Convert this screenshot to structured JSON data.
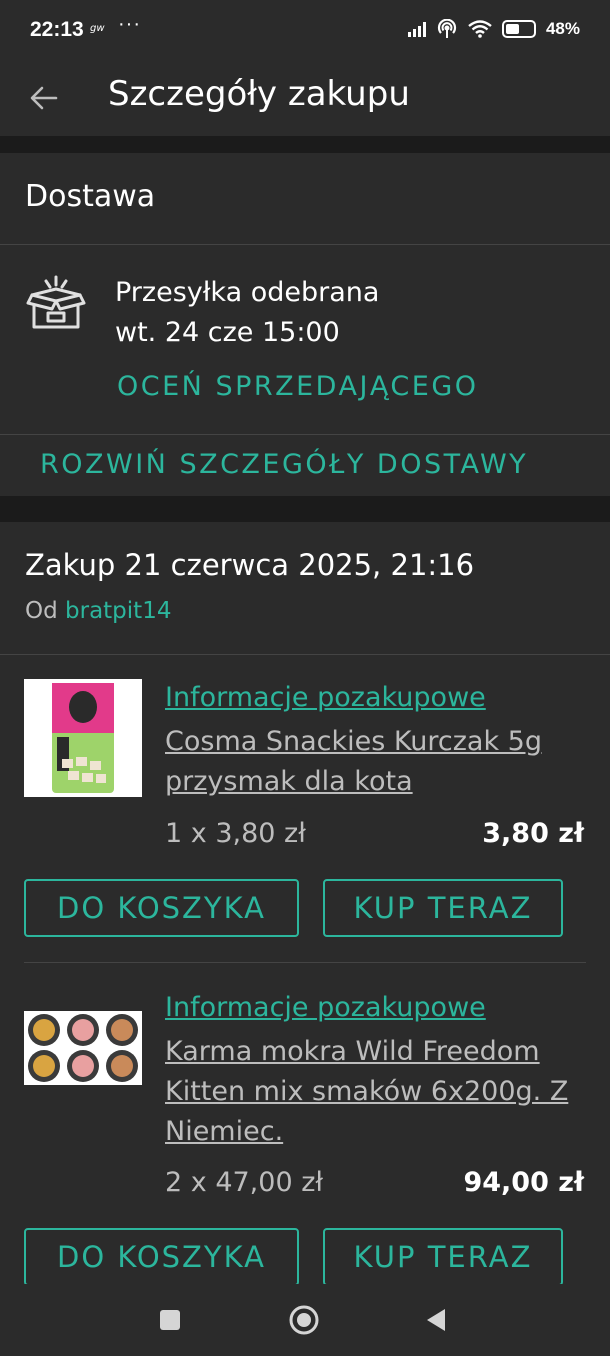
{
  "status_bar": {
    "time": "22:13",
    "notification_icon": "jackdaw-notification-icon",
    "more": "···",
    "battery": "48%"
  },
  "app_bar": {
    "title": "Szczegóły zakupu"
  },
  "delivery": {
    "section_title": "Dostawa",
    "status": "Przesyłka odebrana",
    "date": "wt. 24 cze 15:00",
    "rate_seller": "OCEŃ SPRZEDAJĄCEGO",
    "expand_details": "ROZWIŃ SZCZEGÓŁY DOSTAWY"
  },
  "purchase": {
    "date": "Zakup 21 czerwca 2025, 21:16",
    "from_label": "Od",
    "seller": "bratpit14",
    "items": [
      {
        "info_link": "Informacje pozakupowe",
        "name": "Cosma Snackies Kurczak 5g przysmak dla kota",
        "quantity_price": "1 x 3,80 zł",
        "total": "3,80 zł",
        "add_to_cart": "DO KOSZYKA",
        "buy_now": "KUP TERAZ"
      },
      {
        "info_link": "Informacje pozakupowe",
        "name": "Karma mokra Wild Freedom Kitten mix smaków 6x200g. Z Niemiec.",
        "quantity_price": "2 x 47,00 zł",
        "total": "94,00 zł",
        "add_to_cart": "DO KOSZYKA",
        "buy_now": "KUP TERAZ"
      }
    ]
  },
  "colors": {
    "accent": "#2cb69d",
    "background": "#1b1b1b",
    "card": "#2b2b2b"
  }
}
